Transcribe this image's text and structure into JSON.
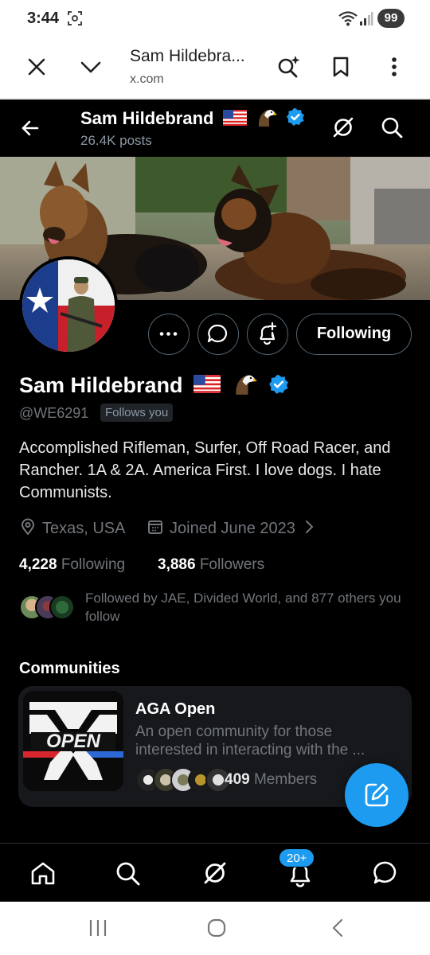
{
  "status_bar": {
    "time": "3:44",
    "battery": "99"
  },
  "browser": {
    "page_title": "Sam Hildebra...",
    "url": "x.com"
  },
  "header": {
    "name": "Sam Hildebrand",
    "posts": "26.4K posts"
  },
  "profile": {
    "name": "Sam Hildebrand",
    "handle": "@WE6291",
    "follows_you": "Follows you",
    "bio": "Accomplished Rifleman, Surfer, Off Road Racer, and Rancher. 1A & 2A. America First. I love dogs. I hate Communists.",
    "location": "Texas, USA",
    "joined": "Joined June 2023",
    "following_count": "4,228",
    "following_label": "Following",
    "followers_count": "3,886",
    "followers_label": "Followers",
    "followed_by": "Followed by JAE, Divided World, and 877 others you follow",
    "follow_button": "Following"
  },
  "communities": {
    "title": "Communities",
    "items": [
      {
        "name": "AGA Open",
        "description": "An open community for those interested in interacting with the ...",
        "members_count": "409",
        "members_label": "Members",
        "logo_text": "OPEN"
      }
    ]
  },
  "bottom_nav": {
    "notifications_badge": "20+"
  },
  "colors": {
    "accent": "#1d9bf0",
    "background": "#000000",
    "muted": "#71767b",
    "card": "#16181c"
  }
}
